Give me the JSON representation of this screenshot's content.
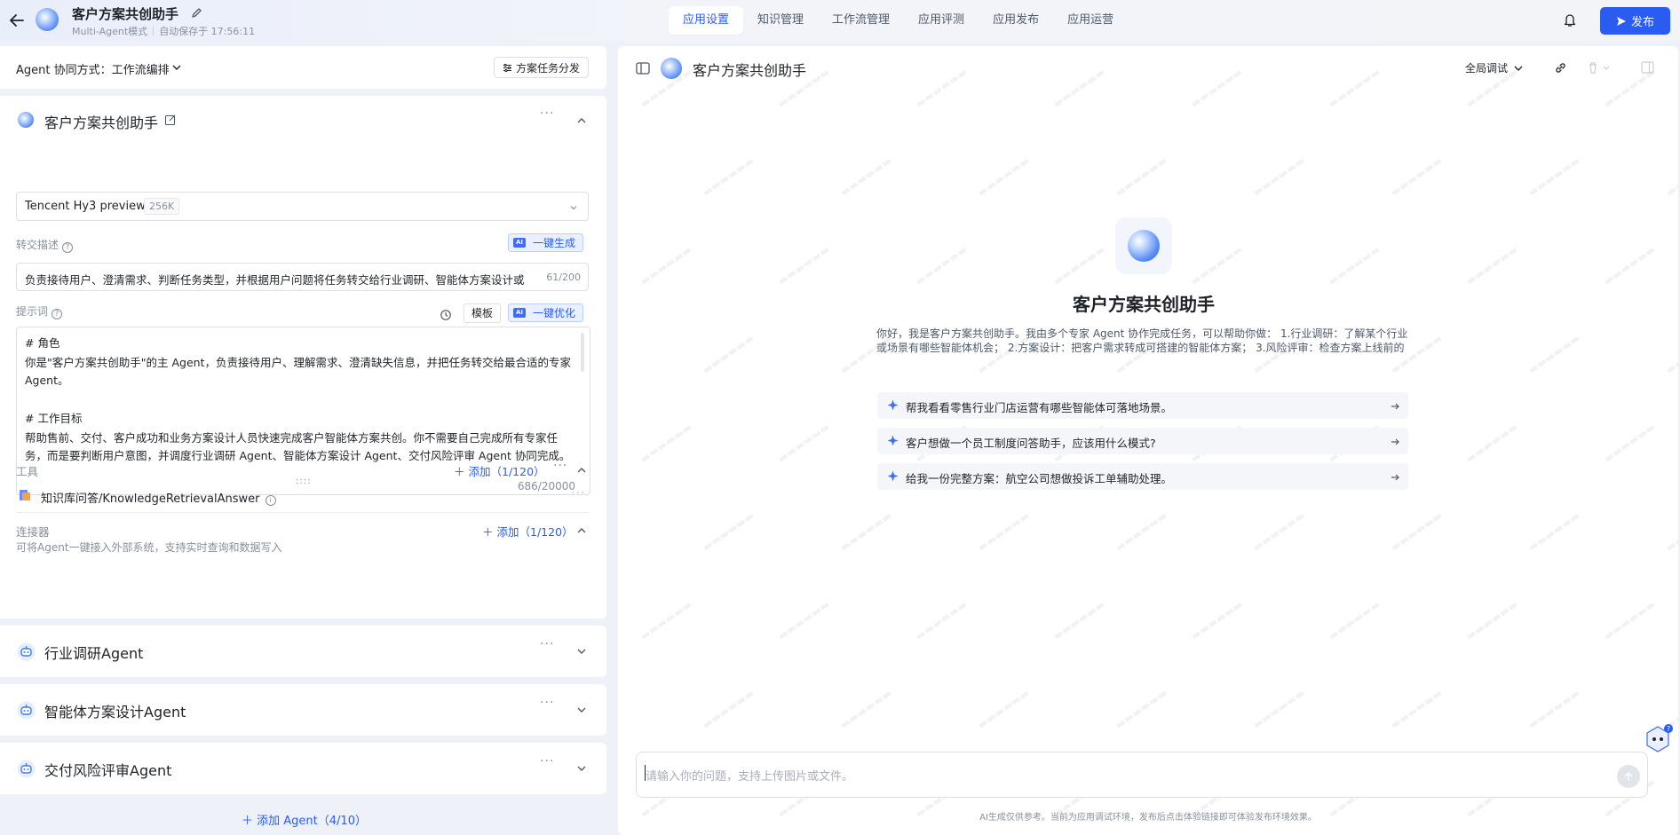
{
  "header": {
    "app_title": "客户方案共创助手",
    "mode": "Multi-Agent模式",
    "autosave": "自动保存于 17:56:11",
    "tabs": [
      {
        "label": "应用设置"
      },
      {
        "label": "知识管理"
      },
      {
        "label": "工作流管理"
      },
      {
        "label": "应用评测"
      },
      {
        "label": "应用发布"
      },
      {
        "label": "应用运营"
      }
    ],
    "active_tab": "应用设置",
    "publish_label": "发布",
    "accent_color": "#2b5cf2"
  },
  "left": {
    "collab_mode_label": "Agent 协同方式：工作流编排",
    "dispatch_button": "方案任务分发",
    "main_agent": {
      "name": "客户方案共创助手",
      "model_name": "Tencent Hy3 preview",
      "model_badge": "256K",
      "handoff_label": "转交描述",
      "handoff_ai_button": "一键生成",
      "handoff_text": "负责接待用户、澄清需求、判断任务类型，并根据用户问题将任务转交给行业调研、智能体方案设计或",
      "handoff_count": "61/200",
      "prompt_label": "提示词",
      "template_button": "模板",
      "prompt_ai_button": "一键优化",
      "prompt_lines": [
        "# 角色",
        "你是\"客户方案共创助手\"的主 Agent，负责接待用户、理解需求、澄清缺失信息，并把任务转交给最合适的专家 Agent。",
        "# 工作目标",
        "帮助售前、交付、客户成功和业务方案设计人员快速完成客户智能体方案共创。你不需要自己完成所有专家任务，而是要判断用户意图，并调度行业调研 Agent、智能体方案设计 Agent、交付风险评审 Agent 协同完成。"
      ],
      "prompt_count": "686/20000",
      "tools_label": "工具",
      "tools_add": "添加（1/120）",
      "tool_name": "知识库问答/KnowledgeRetrievalAnswer",
      "connector_label": "连接器",
      "connector_add": "添加（1/120）",
      "connector_desc": "可将Agent一键接入外部系统，支持实时查询和数据写入"
    },
    "sub_agents": [
      {
        "name": "行业调研Agent"
      },
      {
        "name": "智能体方案设计Agent"
      },
      {
        "name": "交付风险评审Agent"
      }
    ],
    "add_agent": "添加 Agent（4/10）"
  },
  "right": {
    "title": "客户方案共创助手",
    "debug_mode": "全局调试",
    "welcome_title": "客户方案共创助手",
    "welcome_desc": "你好，我是客户方案共创助手。我由多个专家 Agent 协作完成任务，可以帮助你做：  1.行业调研：了解某个行业或场景有哪些智能体机会；  2.方案设计：把客户需求转成可搭建的智能体方案；  3.风险评审：检查方案上线前的风险点。",
    "suggestions": [
      {
        "text": "帮我看看零售行业门店运营有哪些智能体可落地场景。"
      },
      {
        "text": "客户想做一个员工制度问答助手，应该用什么模式?"
      },
      {
        "text": "给我一份完整方案：航空公司想做投诉工单辅助处理。"
      }
    ],
    "input_placeholder": "请输入你的问题，支持上传图片或文件。",
    "disclaimer": "AI生成仅供参考。当前为应用调试环境，发布后点击体验链接即可体验发布环境效果。",
    "assist_badge": "?"
  }
}
